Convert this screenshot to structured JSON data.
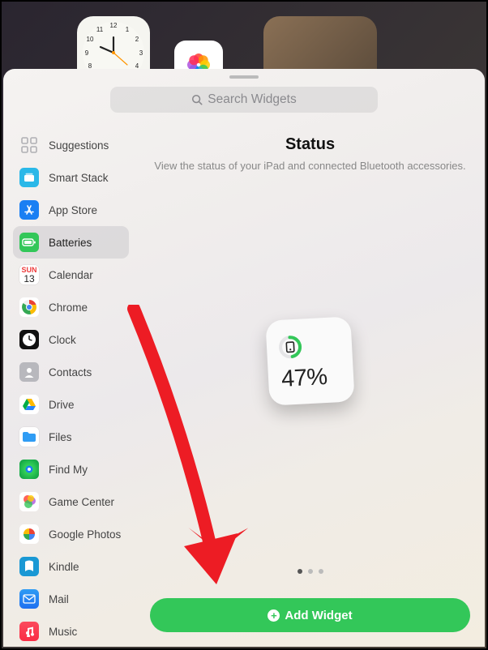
{
  "search": {
    "placeholder": "Search Widgets"
  },
  "sidebar": {
    "items": [
      {
        "label": "Suggestions"
      },
      {
        "label": "Smart Stack"
      },
      {
        "label": "App Store"
      },
      {
        "label": "Batteries"
      },
      {
        "label": "Calendar",
        "weekday": "SUN",
        "day": "13"
      },
      {
        "label": "Chrome"
      },
      {
        "label": "Clock"
      },
      {
        "label": "Contacts"
      },
      {
        "label": "Drive"
      },
      {
        "label": "Files"
      },
      {
        "label": "Find My"
      },
      {
        "label": "Game Center"
      },
      {
        "label": "Google Photos"
      },
      {
        "label": "Kindle"
      },
      {
        "label": "Mail"
      },
      {
        "label": "Music"
      }
    ],
    "selected_index": 3
  },
  "detail": {
    "title": "Status",
    "subtitle": "View the status of your iPad and connected Bluetooth accessories.",
    "battery_percent": "47%",
    "battery_value": 47,
    "page_count": 3,
    "page_index": 0
  },
  "add_button": {
    "label": "Add Widget"
  },
  "colors": {
    "accent_green": "#33c759",
    "arrow_red": "#ed1c24"
  }
}
